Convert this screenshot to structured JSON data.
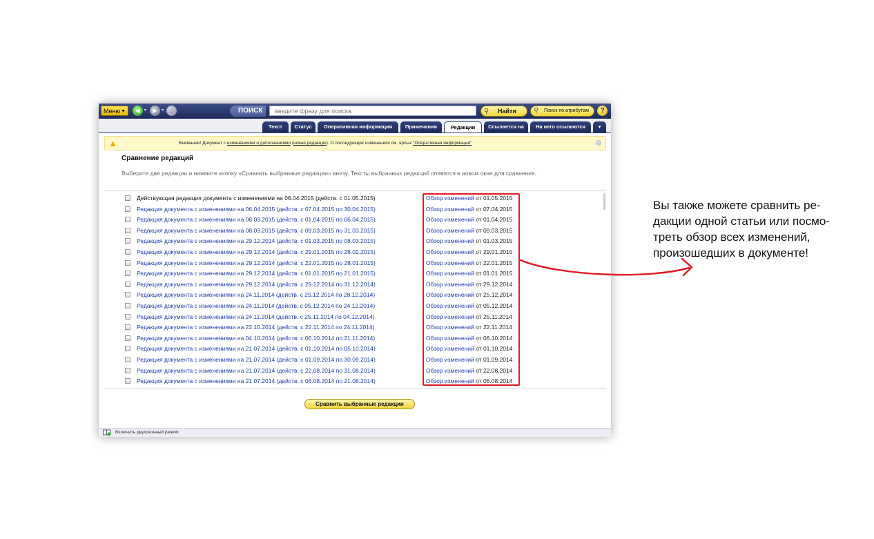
{
  "toolbar": {
    "menu_label": "Меню",
    "search_label": "ПОИСК",
    "search_placeholder": "введите фразу для поиска",
    "find_label": "Найти",
    "attr_search_label": "Поиск по атрибутам",
    "help_label": "?"
  },
  "tabs": [
    {
      "label": "Текст",
      "active": false
    },
    {
      "label": "Статус",
      "active": false
    },
    {
      "label": "Оперативная информация",
      "active": false
    },
    {
      "label": "Примечания",
      "active": false
    },
    {
      "label": "Редакции",
      "active": true
    },
    {
      "label": "Ссылается на",
      "active": false
    },
    {
      "label": "На него ссылаются",
      "active": false
    }
  ],
  "notice": {
    "prefix": "Внимание! Документ с ",
    "link1": "изменениями и дополнениями",
    "mid1": " (",
    "link2": "новая редакция",
    "mid2": "). О последующих изменениях см. ярлык ",
    "link3": "\"Оперативная информация\""
  },
  "page": {
    "heading": "Сравнение редакций",
    "subtitle": "Выберите две редакции и нажмите кнопку «Сравнить выбранные редакции» внизу. Тексты выбранных редакций появятся в новом окне для сравнения."
  },
  "review_link_label": "Обзор изменений",
  "date_prefix": "от",
  "revisions": [
    {
      "title": "Действующая редакция документа с изменениями на 06.04.2015 (действ. с 01.05.2015)",
      "review_date": "01.05.2015"
    },
    {
      "title": "Редакция документа с изменениями на 06.04.2015 (действ. с 07.04.2015 по 30.04.2015)",
      "review_date": "07.04.2015"
    },
    {
      "title": "Редакция документа с изменениями на 08.03.2015 (действ. с 01.04.2015 по 06.04.2015)",
      "review_date": "01.04.2015"
    },
    {
      "title": "Редакция документа с изменениями на 08.03.2015 (действ. с 09.03.2015 по 31.03.2015)",
      "review_date": "09.03.2015"
    },
    {
      "title": "Редакция документа с изменениями на 29.12.2014 (действ. с 01.03.2015 по 08.03.2015)",
      "review_date": "01.03.2015"
    },
    {
      "title": "Редакция документа с изменениями на 29.12.2014 (действ. с 29.01.2015 по 28.02.2015)",
      "review_date": "29.01.2015"
    },
    {
      "title": "Редакция документа с изменениями на 29.12.2014 (действ. с 22.01.2015 по 28.01.2015)",
      "review_date": "22.01.2015"
    },
    {
      "title": "Редакция документа с изменениями на 29.12.2014 (действ. с 01.01.2015 по 21.01.2015)",
      "review_date": "01.01.2015"
    },
    {
      "title": "Редакция документа с изменениями на 29.12.2014 (действ. с 29.12.2014 по 31.12.2014)",
      "review_date": "29.12.2014"
    },
    {
      "title": "Редакция документа с изменениями на 24.11.2014 (действ. с 25.12.2014 по 28.12.2014)",
      "review_date": "25.12.2014"
    },
    {
      "title": "Редакция документа с изменениями на 24.11.2014 (действ. с 05.12.2014 по 24.12.2014)",
      "review_date": "05.12.2014"
    },
    {
      "title": "Редакция документа с изменениями на 24.11.2014 (действ. с 25.11.2014 по 04.12.2014)",
      "review_date": "25.11.2014"
    },
    {
      "title": "Редакция документа с изменениями на 22.10.2014 (действ. с 22.11.2014 по 24.11.2014)",
      "review_date": "22.11.2014"
    },
    {
      "title": "Редакция документа с изменениями на 04.10.2014 (действ. с 06.10.2014 по 21.11.2014)",
      "review_date": "06.10.2014"
    },
    {
      "title": "Редакция документа с изменениями на 21.07.2014 (действ. с 01.10.2014 по 05.10.2014)",
      "review_date": "01.10.2014"
    },
    {
      "title": "Редакция документа с изменениями на 21.07.2014 (действ. с 01.09.2014 по 30.09.2014)",
      "review_date": "01.09.2014"
    },
    {
      "title": "Редакция документа с изменениями на 21.07.2014 (действ. с 22.08.2014 по 31.08.2014)",
      "review_date": "22.08.2014"
    },
    {
      "title": "Редакция документа с изменениями на 21.07.2014 (действ. с 06.08.2014 по 21.08.2014)",
      "review_date": "06.08.2014"
    }
  ],
  "compare_button_label": "Сравнить выбранные редакции",
  "statusbar": {
    "dual_mode_label": "Включить двухоконный режим"
  },
  "callout": {
    "lines": [
      "Вы также можете сравнить ре-",
      "дакции одной статьи или посмо-",
      "треть обзор всех изменений,",
      "произошедших в документе!"
    ]
  },
  "colors": {
    "toolbar": "#1f2b5a",
    "link": "#1f3bb3",
    "highlight": "#e01b24",
    "button": "#f2d63c",
    "notice_bg": "#fff8c9"
  }
}
